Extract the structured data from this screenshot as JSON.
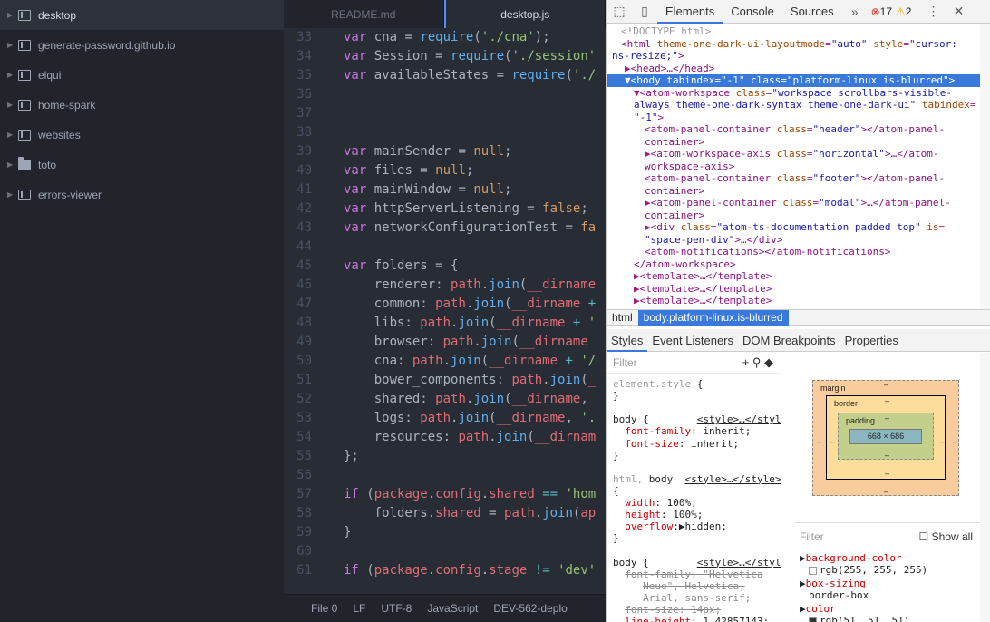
{
  "tree": {
    "projects": [
      {
        "name": "desktop",
        "type": "repo",
        "selected": true
      },
      {
        "name": "generate-password.github.io",
        "type": "repo"
      },
      {
        "name": "elqui",
        "type": "repo"
      },
      {
        "name": "home-spark",
        "type": "repo"
      },
      {
        "name": "websites",
        "type": "repo"
      },
      {
        "name": "toto",
        "type": "folder"
      },
      {
        "name": "errors-viewer",
        "type": "repo"
      }
    ]
  },
  "editor": {
    "tabs": [
      "README.md",
      "desktop.js"
    ],
    "active_tab": "desktop.js",
    "lines": [
      {
        "n": "33",
        "html": "<span class='k'>var</span> cna = <span class='f'>require</span>(<span class='s'>'./cna'</span>);"
      },
      {
        "n": "34",
        "html": "<span class='k'>var</span> Session = <span class='f'>require</span>(<span class='s'>'./session'</span>"
      },
      {
        "n": "35",
        "html": "<span class='k'>var</span> availableStates = <span class='f'>require</span>(<span class='s'>'./</span>"
      },
      {
        "n": "36",
        "html": ""
      },
      {
        "n": "37",
        "html": ""
      },
      {
        "n": "38",
        "html": ""
      },
      {
        "n": "39",
        "html": "<span class='k'>var</span> mainSender = <span class='c'>null</span>;"
      },
      {
        "n": "40",
        "html": "<span class='k'>var</span> files = <span class='c'>null</span>;"
      },
      {
        "n": "41",
        "html": "<span class='k'>var</span> mainWindow = <span class='c'>null</span>;"
      },
      {
        "n": "42",
        "html": "<span class='k'>var</span> httpServerListening = <span class='c'>false</span>;"
      },
      {
        "n": "43",
        "html": "<span class='k'>var</span> networkConfigurationTest = <span class='c'>fa</span>"
      },
      {
        "n": "44",
        "html": ""
      },
      {
        "n": "45",
        "html": "<span class='k'>var</span> folders = {"
      },
      {
        "n": "46",
        "html": "    renderer: <span class='p'>path</span>.<span class='f'>join</span>(<span class='p'>__dirname</span>"
      },
      {
        "n": "47",
        "html": "    common: <span class='p'>path</span>.<span class='f'>join</span>(<span class='p'>__dirname</span> <span class='t'>+</span>"
      },
      {
        "n": "48",
        "html": "    libs: <span class='p'>path</span>.<span class='f'>join</span>(<span class='p'>__dirname</span> <span class='t'>+</span> <span class='s'>'</span>"
      },
      {
        "n": "49",
        "html": "    browser: <span class='p'>path</span>.<span class='f'>join</span>(<span class='p'>__dirname</span>"
      },
      {
        "n": "50",
        "html": "    cna: <span class='p'>path</span>.<span class='f'>join</span>(<span class='p'>__dirname</span> <span class='t'>+</span> <span class='s'>'/</span>"
      },
      {
        "n": "51",
        "html": "    bower_components: <span class='p'>path</span>.<span class='f'>join</span>(<span class='p'>_</span>"
      },
      {
        "n": "52",
        "html": "    shared: <span class='p'>path</span>.<span class='f'>join</span>(<span class='p'>__dirname</span>,"
      },
      {
        "n": "53",
        "html": "    logs: <span class='p'>path</span>.<span class='f'>join</span>(<span class='p'>__dirname</span>, <span class='s'>'.</span>"
      },
      {
        "n": "54",
        "html": "    resources: <span class='p'>path</span>.<span class='f'>join</span>(<span class='p'>__dirnam</span>"
      },
      {
        "n": "55",
        "html": "};"
      },
      {
        "n": "56",
        "html": ""
      },
      {
        "n": "57",
        "html": "<span class='k'>if</span> (<span class='p'>package</span>.<span class='p'>config</span>.<span class='p'>shared</span> <span class='t'>==</span> <span class='s'>'hom</span>"
      },
      {
        "n": "58",
        "html": "    folders.<span class='p'>shared</span> = <span class='p'>path</span>.<span class='f'>join</span>(<span class='p'>ap</span>"
      },
      {
        "n": "59",
        "html": "}"
      },
      {
        "n": "60",
        "html": ""
      },
      {
        "n": "61",
        "html": "<span class='k'>if</span> (<span class='p'>package</span>.<span class='p'>config</span>.<span class='p'>stage</span> <span class='t'>!=</span> <span class='s'>'dev'</span>"
      }
    ],
    "status": {
      "file": "File 0",
      "eol": "LF",
      "encoding": "UTF-8",
      "grammar": "JavaScript",
      "branch": "DEV-562-deplo"
    }
  },
  "devtools": {
    "tabs": [
      "Elements",
      "Console",
      "Sources"
    ],
    "active_tab": "Elements",
    "errors": "17",
    "warnings": "2",
    "breadcrumbs": [
      "html",
      "body.platform-linux.is-blurred"
    ],
    "subtabs": [
      "Styles",
      "Event Listeners",
      "DOM Breakpoints",
      "Properties"
    ],
    "filter_placeholder": "Filter",
    "show_all": "Show all",
    "box": {
      "margin": "margin",
      "border": "border",
      "padding": "padding",
      "content": "668 × 686",
      "dash": "–"
    },
    "computed": [
      {
        "prop": "background-color",
        "val": "rgb(255, 255, 255)",
        "swatch": "#ffffff"
      },
      {
        "prop": "box-sizing",
        "val": "border-box"
      },
      {
        "prop": "color",
        "val": "rgb(51, 51, 51)",
        "swatch": "#333333"
      }
    ]
  }
}
